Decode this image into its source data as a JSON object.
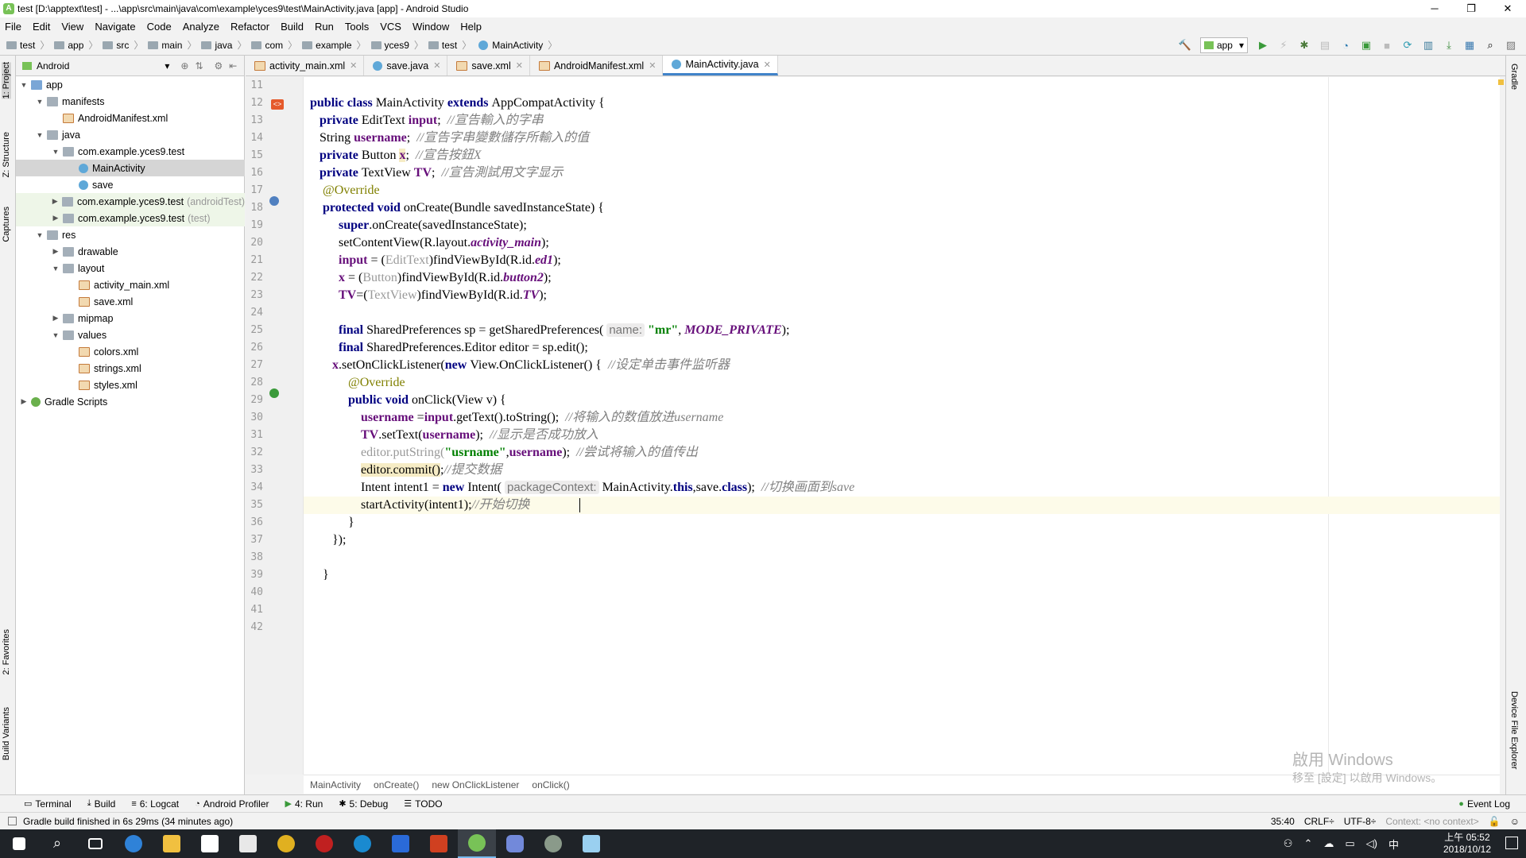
{
  "window": {
    "title": "test [D:\\apptext\\test] - ...\\app\\src\\main\\java\\com\\example\\yces9\\test\\MainActivity.java [app] - Android Studio"
  },
  "menu": [
    "File",
    "Edit",
    "View",
    "Navigate",
    "Code",
    "Analyze",
    "Refactor",
    "Build",
    "Run",
    "Tools",
    "VCS",
    "Window",
    "Help"
  ],
  "breadcrumb": [
    "test",
    "app",
    "src",
    "main",
    "java",
    "com",
    "example",
    "yces9",
    "test",
    "MainActivity"
  ],
  "toolbar": {
    "run_config": "app"
  },
  "left_strip": {
    "project": "1: Project",
    "structure": "Z: Structure",
    "captures": "Captures",
    "favorites": "2: Favorites",
    "build_variants": "Build Variants"
  },
  "right_strip": {
    "gradle": "Gradle",
    "device_explorer": "Device File Explorer"
  },
  "project_panel": {
    "view": "Android",
    "tree": [
      {
        "label": "app",
        "depth": 0,
        "icon": "app"
      },
      {
        "label": "manifests",
        "depth": 1,
        "icon": "folder"
      },
      {
        "label": "AndroidManifest.xml",
        "depth": 2,
        "icon": "xml"
      },
      {
        "label": "java",
        "depth": 1,
        "icon": "folder"
      },
      {
        "label": "com.example.yces9.test",
        "depth": 2,
        "icon": "folder"
      },
      {
        "label": "MainActivity",
        "depth": 3,
        "icon": "class",
        "selected": true
      },
      {
        "label": "save",
        "depth": 3,
        "icon": "class"
      },
      {
        "label": "com.example.yces9.test",
        "suffix": "(androidTest)",
        "depth": 2,
        "icon": "folder",
        "highlight": true
      },
      {
        "label": "com.example.yces9.test",
        "suffix": "(test)",
        "depth": 2,
        "icon": "folder",
        "highlight": true
      },
      {
        "label": "res",
        "depth": 1,
        "icon": "folder"
      },
      {
        "label": "drawable",
        "depth": 2,
        "icon": "folder"
      },
      {
        "label": "layout",
        "depth": 2,
        "icon": "folder"
      },
      {
        "label": "activity_main.xml",
        "depth": 3,
        "icon": "xml"
      },
      {
        "label": "save.xml",
        "depth": 3,
        "icon": "xml"
      },
      {
        "label": "mipmap",
        "depth": 2,
        "icon": "folder"
      },
      {
        "label": "values",
        "depth": 2,
        "icon": "folder"
      },
      {
        "label": "colors.xml",
        "depth": 3,
        "icon": "xml"
      },
      {
        "label": "strings.xml",
        "depth": 3,
        "icon": "xml"
      },
      {
        "label": "styles.xml",
        "depth": 3,
        "icon": "xml"
      },
      {
        "label": "Gradle Scripts",
        "depth": 0,
        "icon": "gradle"
      }
    ]
  },
  "tabs": [
    {
      "label": "activity_main.xml",
      "active": false
    },
    {
      "label": "save.java",
      "active": false
    },
    {
      "label": "save.xml",
      "active": false
    },
    {
      "label": "AndroidManifest.xml",
      "active": false
    },
    {
      "label": "MainActivity.java",
      "active": true
    }
  ],
  "line_numbers": [
    "11",
    "12",
    "13",
    "14",
    "15",
    "16",
    "17",
    "18",
    "19",
    "20",
    "21",
    "22",
    "23",
    "24",
    "25",
    "26",
    "27",
    "28",
    "29",
    "30",
    "31",
    "32",
    "33",
    "34",
    "35",
    "36",
    "37",
    "38",
    "39",
    "40",
    "41",
    "42"
  ],
  "code_breadcrumb": [
    "MainActivity",
    "onCreate()",
    "new OnClickListener",
    "onClick()"
  ],
  "bottom_tools": [
    "Terminal",
    "Build",
    "6: Logcat",
    "Android Profiler",
    "4: Run",
    "5: Debug",
    "TODO"
  ],
  "event_log": "Event Log",
  "status": {
    "message": "Gradle build finished in 6s 29ms (34 minutes ago)",
    "position": "35:40",
    "line_sep": "CRLF÷",
    "encoding": "UTF-8÷",
    "context": "Context: <no context>"
  },
  "watermark": {
    "line1": "啟用 Windows",
    "line2": "移至 [設定] 以啟用 Windows。"
  },
  "clock": {
    "time": "上午 05:52",
    "date": "2018/10/12"
  },
  "tray_ime": "中",
  "code": {
    "l12": {
      "a": "public class ",
      "b": "MainActivity ",
      "c": "extends ",
      "d": "AppCompatActivity {"
    },
    "l13": {
      "kw": "private ",
      "t": "EditText ",
      "f": "input",
      "s": ";  ",
      "cm": "//宣告輸入的字串"
    },
    "l14": {
      "t": "String ",
      "f": "username",
      "s": ";  ",
      "cm": "//宣告字串變數儲存所輸入的值"
    },
    "l15": {
      "kw": "private ",
      "t": "Button ",
      "f": "x",
      "s": ";  ",
      "cm": "//宣告按鈕X"
    },
    "l16": {
      "kw": "private ",
      "t": "TextView ",
      "f": "TV",
      "s": ";  ",
      "cm": "//宣告測試用文字显示"
    },
    "l17": {
      "an": "@Override"
    },
    "l18": {
      "kw": "protected void ",
      "t": "onCreate(Bundle savedInstanceState) {"
    },
    "l19": {
      "kw": "super",
      "t": ".onCreate(savedInstanceState);"
    },
    "l20": {
      "t": "setContentView(R.layout.",
      "sf": "activity_main",
      "e": ");"
    },
    "l21": {
      "f": "input",
      "t": " = (",
      "cast": "EditText",
      "t2": ")findViewById(R.id.",
      "sf": "ed1",
      "e": ");"
    },
    "l22": {
      "f": "x",
      "t": " = (",
      "cast": "Button",
      "t2": ")findViewById(R.id.",
      "sf": "button2",
      "e": ");"
    },
    "l23": {
      "f": "TV",
      "t": "=(",
      "cast": "TextView",
      "t2": ")findViewById(R.id.",
      "sf": "TV",
      "e": ");"
    },
    "l25": {
      "kw": "final ",
      "t": "SharedPreferences sp = getSharedPreferences( ",
      "hint": "name:",
      "st": " \"mr\"",
      "t2": ", ",
      "sf": "MODE_PRIVATE",
      "e": ");"
    },
    "l26": {
      "kw": "final ",
      "t": "SharedPreferences.Editor editor = sp.edit();"
    },
    "l27": {
      "f": "x",
      "t": ".setOnClickListener(",
      "kw": "new ",
      "t2": "View.OnClickListener() {  ",
      "cm": "//设定单击事件监听器"
    },
    "l28": {
      "an": "@Override"
    },
    "l29": {
      "kw": "public void ",
      "t": "onClick(View v) {"
    },
    "l30": {
      "f": "username",
      "t": " =",
      "f2": "input",
      "t2": ".getText().toString();  ",
      "cm": "//将输入的数值放进username"
    },
    "l31": {
      "f": "TV",
      "t": ".setText(",
      "f2": "username",
      "t2": ");  ",
      "cm": "//显示是否成功放入"
    },
    "l32": {
      "t": "editor.putString(",
      "st": "\"usrname\"",
      "t2": ",",
      "f": "username",
      "t3": ");  ",
      "cm": "//尝试将输入的值传出"
    },
    "l33": {
      "t": "editor.commit()",
      "t2": ";",
      "cm": "//提交数据"
    },
    "l34": {
      "t": "Intent intent1 = ",
      "kw": "new ",
      "t2": "Intent( ",
      "hint": "packageContext:",
      "t3": " MainActivity.",
      "kw2": "this",
      "t4": ",save.",
      "kw3": "class",
      "t5": ");  ",
      "cm": "//切换画面到save"
    },
    "l35": {
      "t": "startActivity(intent1);",
      "cm": "//开始切换"
    },
    "l36": {
      "t": "}"
    },
    "l37": {
      "t": "});"
    },
    "l39": {
      "t": "}"
    }
  },
  "colors": {
    "accent": "#4083c9",
    "keyword": "#000080",
    "comment": "#808080",
    "string": "#008000",
    "field": "#660e7a"
  }
}
